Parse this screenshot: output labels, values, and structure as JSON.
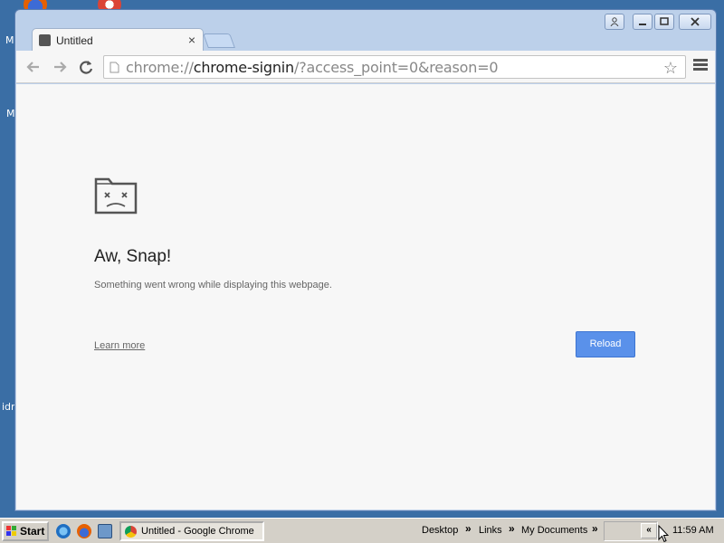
{
  "desktop": {
    "fragments": [
      "M",
      "M",
      "idr"
    ]
  },
  "window": {
    "tab_title": "Untitled",
    "tab_close": "×",
    "url_scheme": "chrome://",
    "url_host": "chrome-signin",
    "url_rest": "/?access_point=0&reason=0",
    "icons": [
      "back-arrow-icon",
      "forward-arrow-icon",
      "reload-icon",
      "page-icon",
      "star-icon",
      "menu-icon",
      "user-icon",
      "minimize-icon",
      "maximize-icon",
      "close-icon"
    ]
  },
  "error_page": {
    "heading": "Aw, Snap!",
    "message": "Something went wrong while displaying this webpage.",
    "learn_more": "Learn more",
    "reload": "Reload"
  },
  "taskbar": {
    "start": "Start",
    "task_button": "Untitled - Google Chrome",
    "toolbars": [
      "Desktop",
      "Links",
      "My Documents"
    ],
    "chevron": "»",
    "tray_chevron": "«",
    "clock": "11:59 AM"
  },
  "colors": {
    "desktop": "#3a6ea5",
    "reload_button": "#5a91ea",
    "window_frame": "#bcd0ea"
  }
}
